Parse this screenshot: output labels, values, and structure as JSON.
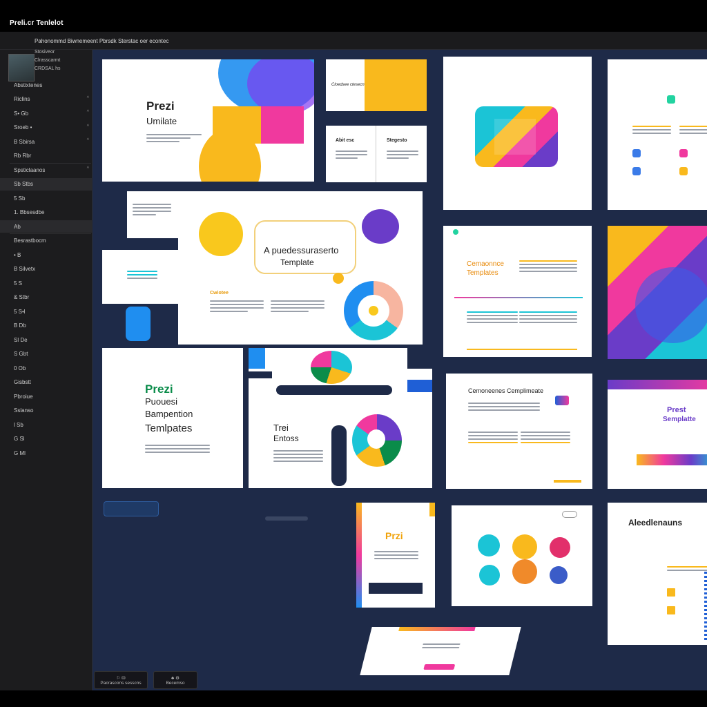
{
  "app": {
    "title": "Preli.cr  Tenlelot",
    "menu_text": "Pahonommd  Biwnemeent Pbrsdk  Sterstac oer econtec"
  },
  "sidebar": {
    "thumb_lines": [
      "Stosiveor",
      "Clrasscarmt",
      "CRDSAL hs"
    ],
    "items": [
      {
        "label": "Abstixtenes",
        "active": false,
        "chevron": false
      },
      {
        "label": "Riclins",
        "active": false,
        "chevron": true
      },
      {
        "label": "S•  Gb",
        "active": false,
        "chevron": true
      },
      {
        "label": "Sroeb •",
        "active": false,
        "chevron": true
      },
      {
        "label": "B  Sbirsa",
        "active": false,
        "chevron": true
      },
      {
        "label": "Rb Rbr",
        "active": false,
        "chevron": false
      },
      {
        "label": "Spsticlaanos",
        "active": false,
        "chevron": true
      },
      {
        "label": "Sb  Stbs",
        "active": true,
        "chevron": false
      },
      {
        "label": "5  Sb",
        "active": false,
        "chevron": false
      },
      {
        "label": "1.   Bbsesdbe",
        "active": false,
        "chevron": false
      },
      {
        "label": "Ab",
        "active": true,
        "chevron": false
      },
      {
        "label": "Besrastbocm",
        "active": false,
        "chevron": false
      },
      {
        "label": "•   B",
        "active": false,
        "chevron": false
      },
      {
        "label": "B   Silvetx",
        "active": false,
        "chevron": false
      },
      {
        "label": "5   S",
        "active": false,
        "chevron": false
      },
      {
        "label": "&   Stbr",
        "active": false,
        "chevron": false
      },
      {
        "label": "5   S•l",
        "active": false,
        "chevron": false
      },
      {
        "label": "B   Db",
        "active": false,
        "chevron": false
      },
      {
        "label": "Sl   De",
        "active": false,
        "chevron": false
      },
      {
        "label": "S   Gbt",
        "active": false,
        "chevron": false
      },
      {
        "label": "0     Ob",
        "active": false,
        "chevron": false
      },
      {
        "label": "Gisbstt",
        "active": false,
        "chevron": false
      },
      {
        "label": "Pbroiue",
        "active": false,
        "chevron": false
      },
      {
        "label": "Sslanso",
        "active": false,
        "chevron": false
      },
      {
        "label": "l   Sb",
        "active": false,
        "chevron": false
      },
      {
        "label": "G   Sl",
        "active": false,
        "chevron": false
      },
      {
        "label": "G   Ml",
        "active": false,
        "chevron": false
      }
    ],
    "bottom_buttons": [
      {
        "label": "Pacrascons sesscns"
      },
      {
        "label": "Becemso"
      }
    ]
  },
  "slides": {
    "s1": {
      "title": "Prezi",
      "subtitle": "Umilate"
    },
    "s2": {
      "text": "Cloedsee ctesecn"
    },
    "s3": {
      "left": "Abit esc",
      "right": "Stegesto"
    },
    "s5": {
      "title": "A puedessuraserto",
      "subtitle": "Template",
      "label": "Cwiotee"
    },
    "s6": {
      "title": "Cemaonnce",
      "subtitle": "Templates"
    },
    "s7": {
      "line1": "Prezi",
      "line2": "Puouesi",
      "line3": "Bampention",
      "line4": "Temlpates"
    },
    "s8": {
      "line1": "Trei",
      "line2": "Entoss"
    },
    "s9": {
      "title": "Cemoneenes Cemplimeate"
    },
    "s10": {
      "title": "Prest",
      "subtitle": "Semplatte"
    },
    "s11": {
      "title": "Przi"
    },
    "s12": {
      "title": "Aleedlenauns"
    }
  },
  "colors": {
    "canvas": "#1e2a48",
    "yellow": "#f9b91d",
    "magenta": "#f0399e",
    "purple": "#6a3cc8",
    "cyan": "#1bc4d6",
    "green": "#0a8c4a"
  }
}
